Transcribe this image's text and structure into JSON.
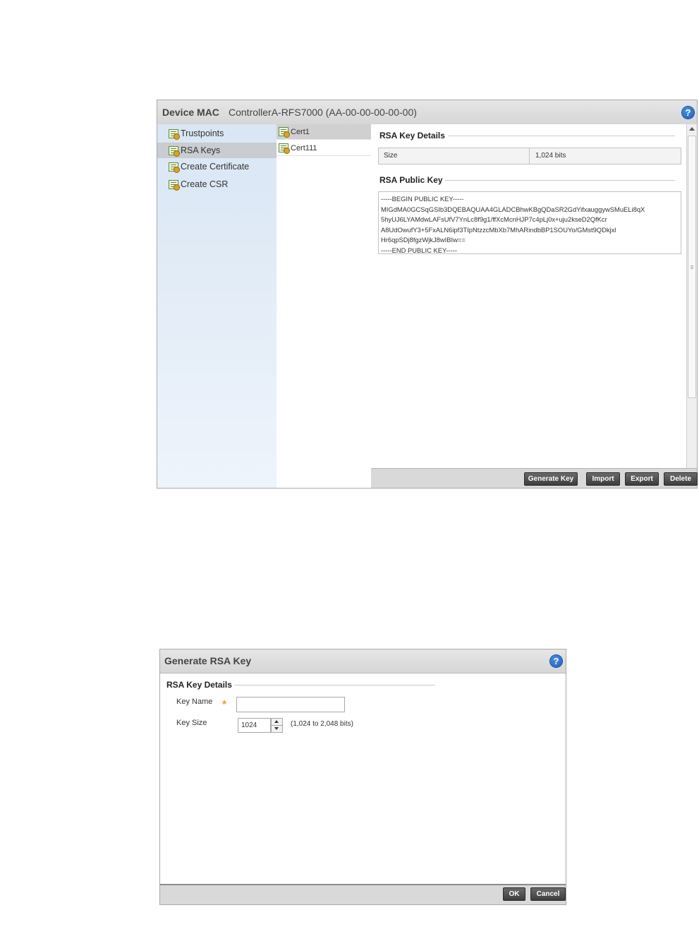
{
  "panel1": {
    "header": {
      "label": "Device MAC",
      "value": "ControllerA-RFS7000 (AA-00-00-00-00-00)"
    },
    "help_icon": "?",
    "nav": [
      {
        "label": "Trustpoints",
        "icon": "certificate-icon"
      },
      {
        "label": "RSA Keys",
        "icon": "certificate-icon",
        "selected": true
      },
      {
        "label": "Create Certificate",
        "icon": "certificate-icon"
      },
      {
        "label": "Create CSR",
        "icon": "certificate-icon"
      }
    ],
    "keys": [
      {
        "label": "Cert1",
        "selected": true
      },
      {
        "label": "Cert111"
      }
    ],
    "details": {
      "section_title": "RSA Key Details",
      "size_label": "Size",
      "size_value": "1,024 bits",
      "public_key_title": "RSA Public Key",
      "public_key_lines": [
        "-----BEGIN PUBLIC KEY-----",
        "MIGdMA0GCSqGSIb3DQEBAQUAA4GLADCBhwKBgQDaSR2GdYifxauggywSMuELi8qX",
        "5hyUJ6LYAMdwLAFsUfV7YnLc8f9g1/ffXcMcnHJP7c4pLj0x+uju2kseD2QfKcr",
        "A8UdOwufY3+5FxALN6ipf3TIpNtzzcMbXb7MhARindbBP1SOUYo/GMst9QDkjxl",
        "Hr6qpSDj8fgzWjkJ8wIBIw==",
        "-----END PUBLIC KEY-----"
      ]
    },
    "footer": {
      "generate_key": "Generate Key",
      "import": "Import",
      "export": "Export",
      "delete": "Delete"
    }
  },
  "panel2": {
    "title": "Generate RSA Key",
    "help_icon": "?",
    "section_title": "RSA Key Details",
    "key_name_label": "Key Name",
    "key_name_value": "",
    "required_mark": "*",
    "key_size_label": "Key Size",
    "key_size_value": "1024",
    "key_size_range": "(1,024 to 2,048 bits)",
    "footer": {
      "ok": "OK",
      "cancel": "Cancel"
    }
  }
}
